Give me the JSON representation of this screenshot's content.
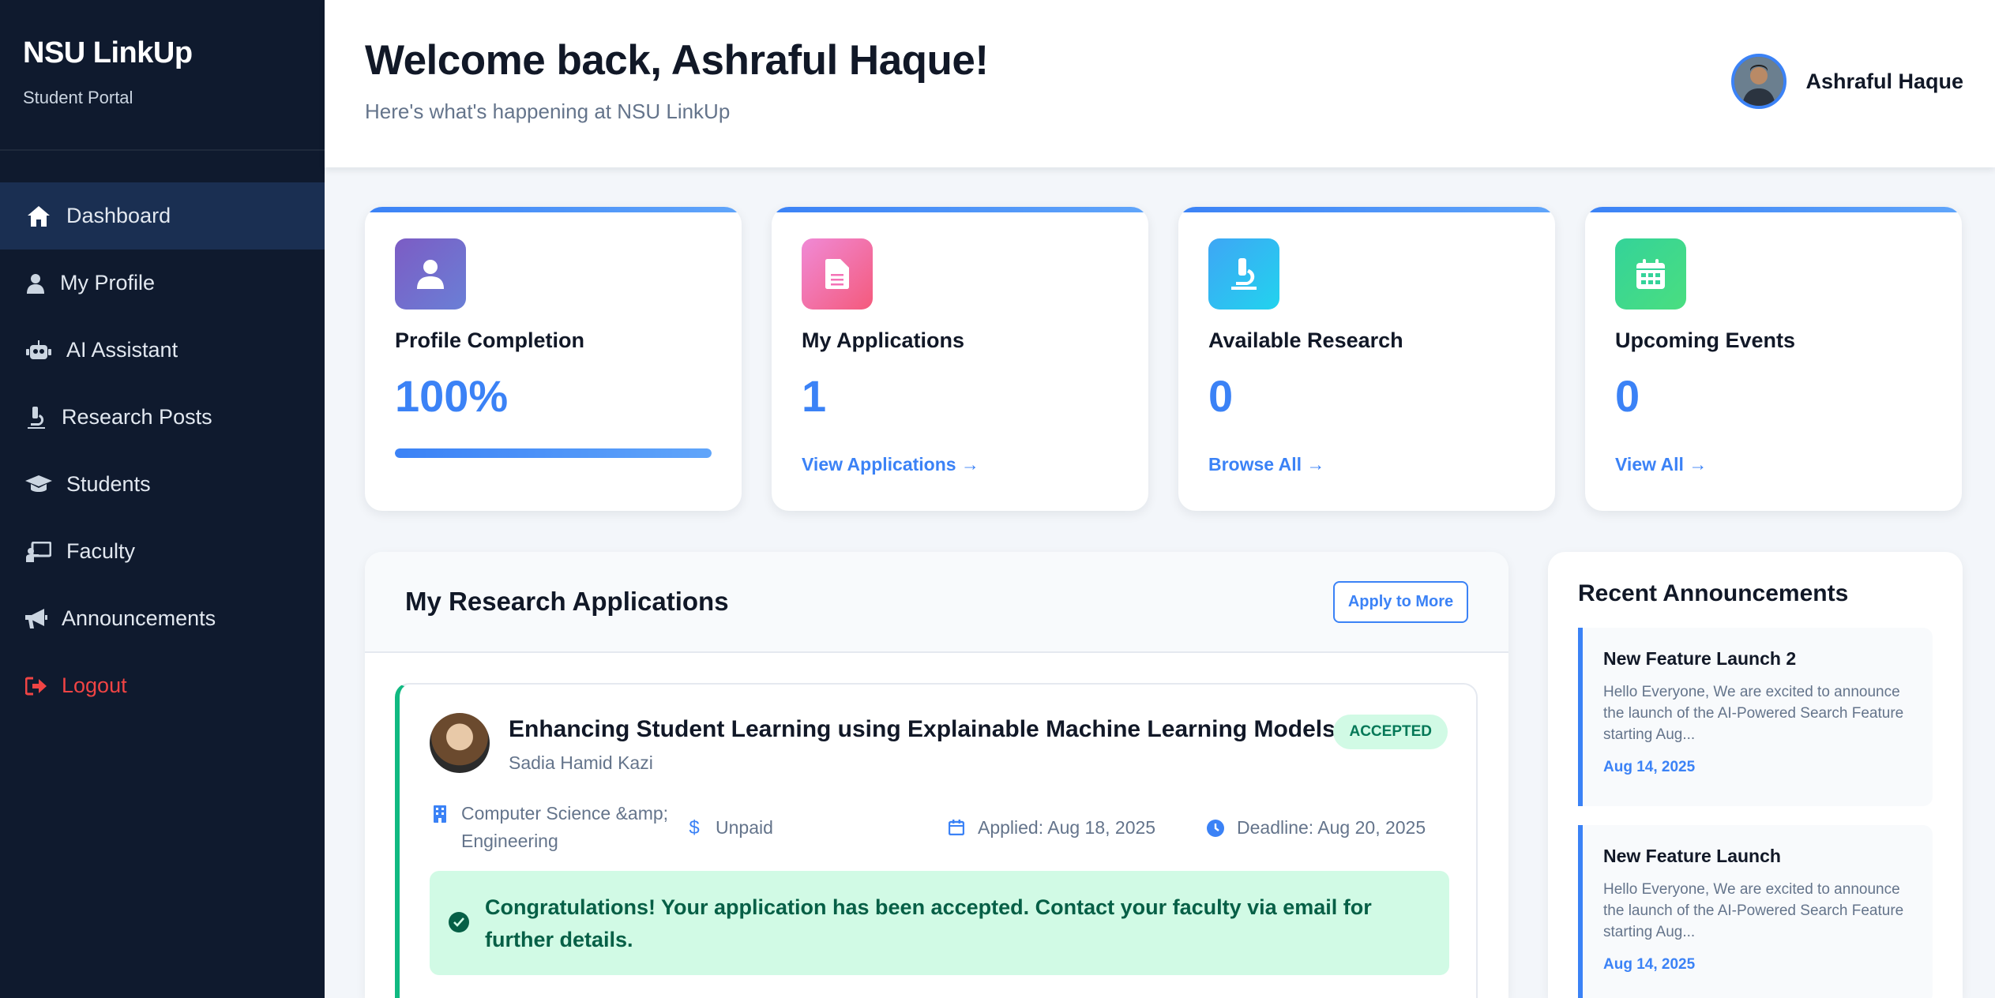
{
  "sidebar": {
    "brand_title": "NSU LinkUp",
    "brand_subtitle": "Student Portal",
    "items": [
      {
        "label": "Dashboard",
        "icon": "home-icon",
        "active": true
      },
      {
        "label": "My Profile",
        "icon": "user-icon"
      },
      {
        "label": "AI Assistant",
        "icon": "robot-icon"
      },
      {
        "label": "Research Posts",
        "icon": "microscope-icon"
      },
      {
        "label": "Students",
        "icon": "graduation-cap-icon"
      },
      {
        "label": "Faculty",
        "icon": "chalkboard-teacher-icon"
      },
      {
        "label": "Announcements",
        "icon": "megaphone-icon"
      },
      {
        "label": "Logout",
        "icon": "logout-icon"
      }
    ]
  },
  "header": {
    "welcome": "Welcome back, Ashraful Haque!",
    "subtitle": "Here's what's happening at NSU LinkUp",
    "user_name": "Ashraful Haque"
  },
  "stats": [
    {
      "title": "Profile Completion",
      "value": "100%",
      "progress": 1.0,
      "icon": "user-icon",
      "icon_gradient": [
        "#7c5cc4",
        "#6a7fd6"
      ]
    },
    {
      "title": "My Applications",
      "value": "1",
      "link": "View Applications →",
      "icon": "file-icon",
      "icon_gradient": [
        "#f08ad6",
        "#f45a7c"
      ]
    },
    {
      "title": "Available Research",
      "value": "0",
      "link": "Browse All →",
      "icon": "microscope-icon",
      "icon_gradient": [
        "#3ea6f5",
        "#22d3ee"
      ]
    },
    {
      "title": "Upcoming Events",
      "value": "0",
      "link": "View All →",
      "icon": "calendar-icon",
      "icon_gradient": [
        "#34d399",
        "#4ade80"
      ]
    }
  ],
  "applications": {
    "title": "My Research Applications",
    "apply_button": "Apply to More",
    "items": [
      {
        "title": "Enhancing Student Learning using Explainable Machine Learning Models",
        "faculty": "Sadia Hamid Kazi",
        "status": "ACCEPTED",
        "department": "Computer Science &amp; Engineering",
        "department_line1": "Computer Science &amp;",
        "department_line2": "Engineering",
        "payment": "Unpaid",
        "applied": "Applied: Aug 18, 2025",
        "deadline": "Deadline: Aug 20, 2025",
        "message": "Congratulations! Your application has been accepted. Contact your faculty via email for further details."
      }
    ]
  },
  "announcements": {
    "title": "Recent Announcements",
    "items": [
      {
        "title": "New Feature Launch 2",
        "body": "Hello Everyone, We are excited to announce the launch of the AI-Powered Search Feature starting Aug...",
        "date": "Aug 14, 2025"
      },
      {
        "title": "New Feature Launch",
        "body": "Hello Everyone, We are excited to announce the launch of the AI-Powered Search Feature starting Aug...",
        "date": "Aug 14, 2025"
      }
    ]
  },
  "colors": {
    "sidebar_bg": "#0f1a2e",
    "accent": "#3b82f6",
    "success": "#10b981",
    "danger": "#f04444"
  }
}
